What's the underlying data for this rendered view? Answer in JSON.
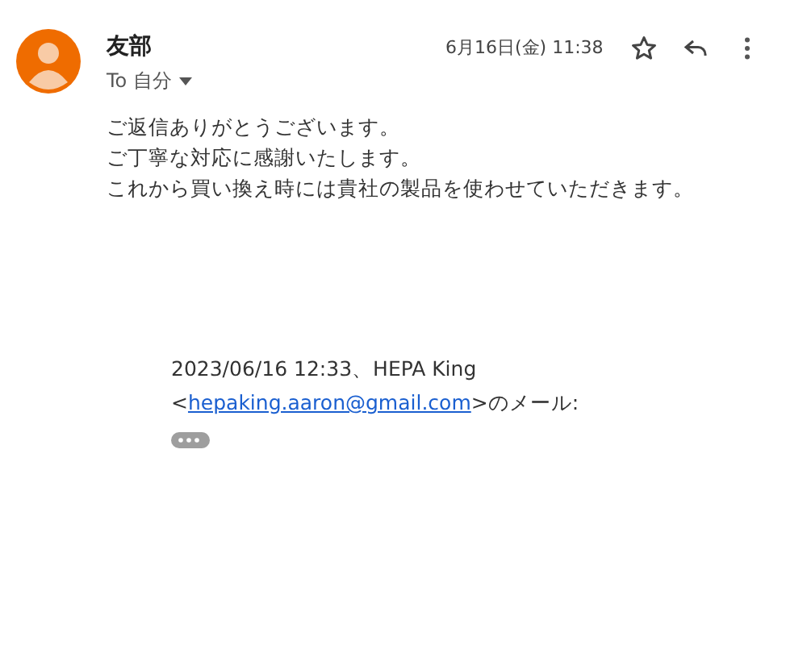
{
  "sender": {
    "name": "友部",
    "recipient": "To 自分"
  },
  "date": "6月16日(金) 11:38",
  "body": [
    "ご返信ありがとうございます。",
    "ご丁寧な対応に感謝いたします。",
    "これから買い換え時には貴社の製品を使わせていただきます。"
  ],
  "quote": {
    "header": "2023/06/16 12:33、HEPA King",
    "before_link": "<",
    "link": "hepaking.aaron@gmail.com",
    "after_link": ">のメール:"
  }
}
